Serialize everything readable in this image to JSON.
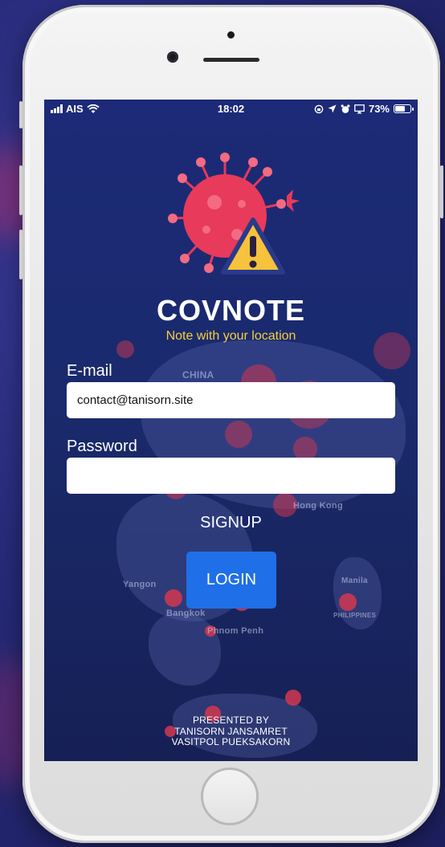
{
  "status_bar": {
    "carrier": "AIS",
    "time": "18:02",
    "battery_percent": "73%",
    "battery_level": 0.73,
    "icons": [
      "signal-bars-icon",
      "wifi-icon",
      "rotation-lock-icon",
      "location-arrow-icon",
      "alarm-icon",
      "airplay-icon",
      "battery-icon"
    ]
  },
  "app": {
    "name": "COVNOTE",
    "tagline": "Note with your location",
    "logo_icon": "virus-warning-icon",
    "colors": {
      "accent": "#1f6fe8",
      "tagline": "#f7cf3c",
      "virus": "#e83a5a",
      "warning": "#f7c23c"
    }
  },
  "form": {
    "email_label": "E-mail",
    "email_value": "contact@tanisorn.site",
    "password_label": "Password",
    "password_value": "",
    "signup_label": "SIGNUP",
    "login_label": "LOGIN"
  },
  "credits": {
    "line1": "PRESENTED BY",
    "line2": "TANISORN JANSAMRET",
    "line3": "VASITPOL PUEKSAKORN"
  },
  "map_labels": {
    "china": "CHINA",
    "hong_kong": "Hong Kong",
    "yangon": "Yangon",
    "bangkok": "Bangkok",
    "phnom_penh": "Phnom Penh",
    "manila": "Manila",
    "philippines": "PHILIPPINES"
  }
}
